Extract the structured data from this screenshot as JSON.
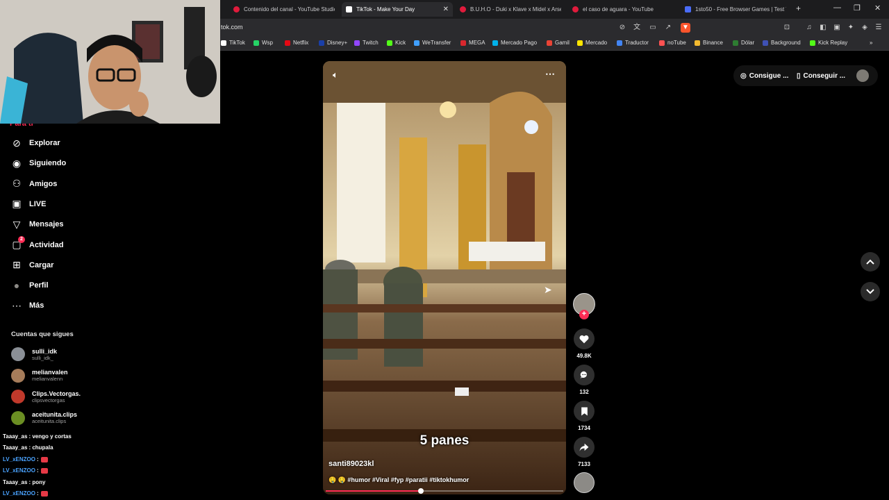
{
  "browser": {
    "tabs": [
      {
        "title": "Contenido del canal - YouTube Studio",
        "color": "#e01b3c"
      },
      {
        "title": "TikTok - Make Your Day",
        "color": "#ffffff"
      },
      {
        "title": "B.U.H.O - Duki x Klave x Midel x Arse",
        "color": "#e01b3c"
      },
      {
        "title": "el caso de aguara - YouTube",
        "color": "#e01b3c"
      },
      {
        "title": "1sto50 - Free Browser Games | Test Y",
        "color": "#4a6cf7"
      }
    ],
    "new_tab": "+",
    "url": "tok.com",
    "bookmarks": [
      {
        "label": "TikTok",
        "color": "#ffffff"
      },
      {
        "label": "Wsp",
        "color": "#25d366"
      },
      {
        "label": "Netflix",
        "color": "#e50914"
      },
      {
        "label": "Disney+",
        "color": "#1a3fa8"
      },
      {
        "label": "Twitch",
        "color": "#9146ff"
      },
      {
        "label": "Kick",
        "color": "#53fc18"
      },
      {
        "label": "WeTransfer",
        "color": "#409fff"
      },
      {
        "label": "MEGA",
        "color": "#d9272e"
      },
      {
        "label": "Mercado Pago",
        "color": "#00b1ea"
      },
      {
        "label": "Gamil",
        "color": "#ea4335"
      },
      {
        "label": "Mercado",
        "color": "#ffe600"
      },
      {
        "label": "Traductor",
        "color": "#4285f4"
      },
      {
        "label": "noTube",
        "color": "#ff5252"
      },
      {
        "label": "Binance",
        "color": "#f3ba2f"
      },
      {
        "label": "Dólar",
        "color": "#2e7d32"
      },
      {
        "label": "Background",
        "color": "#3f51b5"
      },
      {
        "label": "Kick Replay",
        "color": "#53fc18"
      }
    ],
    "more": "»"
  },
  "sidebar": {
    "cut_item": "Para ti",
    "items": [
      {
        "label": "Explorar",
        "icon": "compass-icon"
      },
      {
        "label": "Siguiendo",
        "icon": "following-icon"
      },
      {
        "label": "Amigos",
        "icon": "friends-icon"
      },
      {
        "label": "LIVE",
        "icon": "live-icon"
      },
      {
        "label": "Mensajes",
        "icon": "messages-icon"
      },
      {
        "label": "Actividad",
        "icon": "activity-icon",
        "badge": "2"
      },
      {
        "label": "Cargar",
        "icon": "upload-icon"
      },
      {
        "label": "Perfil",
        "icon": "profile-avatar"
      },
      {
        "label": "Más",
        "icon": "more-icon"
      }
    ],
    "following_title": "Cuentas que sigues",
    "accounts": [
      {
        "name": "sulli_idk",
        "handle": "sulli_idk_",
        "color": "#8a8f96"
      },
      {
        "name": "melianvalen",
        "handle": "melianvalenn",
        "color": "#a67c5a"
      },
      {
        "name": "Clips.Vectorgas.",
        "handle": "clipsvectorgas",
        "color": "#c0392b"
      },
      {
        "name": "aceitunita.clips",
        "handle": "aceitunita.clips",
        "color": "#6b8e23"
      }
    ]
  },
  "chat": [
    {
      "user": "Taaay_as",
      "msg": ": vengo y cortas",
      "color": "#ffffff"
    },
    {
      "user": "Taaay_as",
      "msg": ": chupala",
      "color": "#ffffff"
    },
    {
      "user": "LV_xENZOO",
      "msg": ":",
      "color": "#4aa3ff"
    },
    {
      "user": "LV_xENZOO",
      "msg": ":",
      "color": "#4aa3ff"
    },
    {
      "user": "Taaay_as",
      "msg": ": pony",
      "color": "#ffffff"
    },
    {
      "user": "LV_xENZOO",
      "msg": ":",
      "color": "#4aa3ff"
    }
  ],
  "video": {
    "overlay_text": "5 panes",
    "author": "santi89023kl",
    "description": "🤤 🤤 #humor #Viral #fyp #paratii #tiktokhumor",
    "progress": 0.4
  },
  "actions": {
    "likes": "49.8K",
    "comments": "132",
    "saves": "1734",
    "shares": "7133"
  },
  "topright": {
    "pill1": "Consigue ...",
    "pill2": "Conseguir ..."
  }
}
